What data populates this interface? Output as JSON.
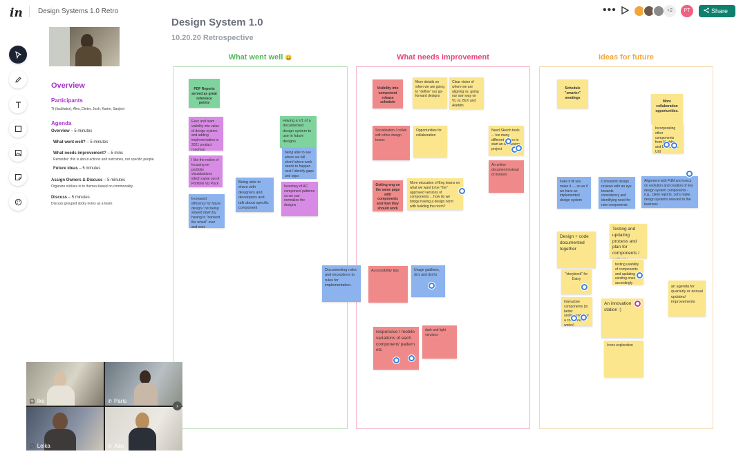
{
  "topbar": {
    "logo": "in",
    "title": "Design Systems 1.0 Retro",
    "more": "•••",
    "extra_count": "+2",
    "me_initials": "PT",
    "share": "Share"
  },
  "overview": {
    "title": "Overview",
    "participants_h": "Participants",
    "participants": "Tt (facilitator), Alex, Dieter, Josh, Karim, Sanjeet",
    "agenda_h": "Agenda",
    "agenda": [
      {
        "title": "Overview",
        "time": " – 5 minutes",
        "note": ""
      },
      {
        "title": "What went well?",
        "time": " – 5 minutes",
        "note": ""
      },
      {
        "title": "What needs improvement?",
        "time": " – 5 mins",
        "note": "Reminder: this is about actions and outcomes, not specific people."
      },
      {
        "title": "Future ideas",
        "time": " – 5 minutes",
        "note": ""
      },
      {
        "title": "Assign Owners & Discuss",
        "time": " – 5 minutes",
        "note": "Organize stickies in to themes based on commonality."
      },
      {
        "title": "Discuss",
        "time": " – 5 minutes",
        "note": "Discuss grouped sticky notes as a team."
      }
    ]
  },
  "board": {
    "title": "Design System 1.0",
    "subtitle": "10.20.20 Retrospective",
    "columns": [
      {
        "title": "What went well",
        "emoji": "😀",
        "color": "#52b85a",
        "border": "#b8e2b6"
      },
      {
        "title": "What needs improvement",
        "color": "#e8457a",
        "border": "#f4b7c9"
      },
      {
        "title": "Ideas for future",
        "color": "#f1a93c",
        "border": "#f6d8ad"
      }
    ]
  },
  "notes_well": [
    "PDF Reports served as great reference points",
    "Exec and team visibility into value of design system and adding implementation to 2021 product roadmap",
    "I like the notion of focusing on portfolio visualizations which came out of Portfolio Viz Pack",
    "Increased efficiency for future design / not being slowed down by having to \"reinvent the wheel\" over and over.",
    "Being able to share with designers and developers and talk about specific component",
    "Having a V1 of a documented design system to use in future designs",
    "being able to see where we fall short/ where work needs to happen next / identify gaps and opps",
    "Inventory of AC component patterns so we can normalize the designs",
    "Documenting rules and exceptions to rules for implementation."
  ],
  "notes_improve": [
    "Visibility into component release schedule",
    "More details on when we are going to \"define\" our go-forward designs",
    "Clear vision of where we are aligning vs. going our own way on VL vs. BLK and Aladdin",
    "Socialization / collab with other design teams",
    "Opportunities for collaboration",
    "Need Sketch tools ... too many different places to start an AC design project",
    "An online document instead of invision",
    "Getting eng on the same page with components and how they should work",
    "More education of Eng teams on what we want to be \"the\" approved versions of components ... how do we bridge having a design norm with building the norm?",
    "Accessibility tips",
    "Usage guidlines, do's and don'ts",
    "responsive / mobile variations of each component/ pattern etc",
    "dark and light versions"
  ],
  "notes_future": [
    "Schedule \"smarter\" meetings",
    "More collaboration opportunities.",
    "Incorporating other components from Aladdin and BlackRock UXI",
    "Fake it till you make it .... so as if we have an implemented design system",
    "Consistent design reviews with an eye towards consistency and identifying need for new components",
    "Alignment with PdM and execs on evolution and creation of key design system components - e.g., client reports. Let's make design systems relevant to the business",
    "Design + code documented together",
    "Testing and updating process and plan for components / patterns outside of project work",
    "testing usability of components and updating existing ones accordingly",
    "\"storybook\" for Daisy",
    "Interactive components (to better understand how a component works)",
    "An innovation station :)",
    "an agenda for quarterly or annual updates/ improvements",
    "Icons exploration"
  ],
  "video": {
    "participants": [
      "Ike",
      "Paris",
      "Leika",
      "Xan"
    ],
    "next": "›"
  },
  "colors": {
    "green_note": "#7fd39c",
    "purple_note": "#d88be4",
    "blue_note": "#8cb3ee",
    "red_note": "#f08a8a",
    "yellow_note": "#fbe68d",
    "share_button": "#0f7f6e",
    "overview_accent": "#a733c9"
  }
}
